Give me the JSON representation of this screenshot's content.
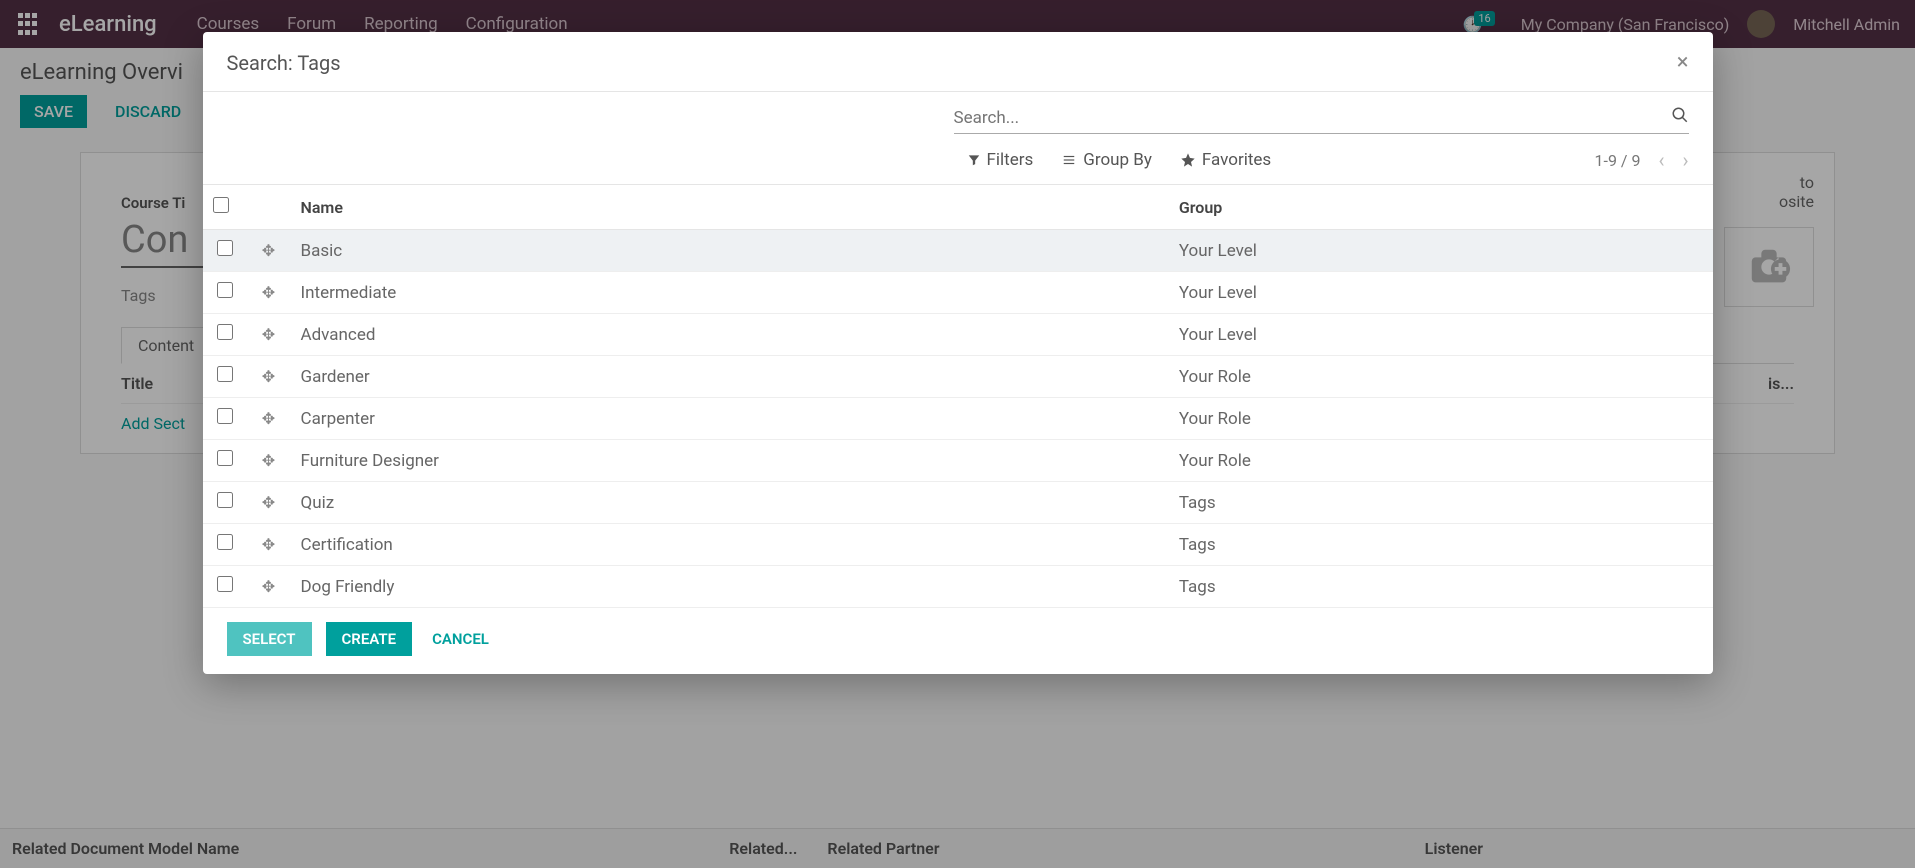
{
  "navbar": {
    "brand": "eLearning",
    "links": [
      "Courses",
      "Forum",
      "Reporting",
      "Configuration"
    ],
    "notif_count": "16",
    "company": "My Company (San Francisco)",
    "user": "Mitchell Admin"
  },
  "page": {
    "breadcrumb": "eLearning Overvi",
    "save": "SAVE",
    "discard": "DISCARD",
    "course_title_label": "Course Ti",
    "course_title_value": "Con",
    "tags_label": "Tags",
    "tabs": [
      "Content"
    ],
    "content_title_header": "Title",
    "add_section": "Add Sect",
    "goto_website_line1": "to",
    "goto_website_line2": "osite",
    "duration_header": "is..."
  },
  "bottom": {
    "c1": "Related Document Model Name",
    "c2": "Related...",
    "c3": "Related Partner",
    "c4": "Listener"
  },
  "modal": {
    "title": "Search: Tags",
    "search_placeholder": "Search...",
    "filters": "Filters",
    "group_by": "Group By",
    "favorites": "Favorites",
    "pager": "1-9 / 9",
    "columns": {
      "name": "Name",
      "group": "Group"
    },
    "rows": [
      {
        "name": "Basic",
        "group": "Your Level"
      },
      {
        "name": "Intermediate",
        "group": "Your Level"
      },
      {
        "name": "Advanced",
        "group": "Your Level"
      },
      {
        "name": "Gardener",
        "group": "Your Role"
      },
      {
        "name": "Carpenter",
        "group": "Your Role"
      },
      {
        "name": "Furniture Designer",
        "group": "Your Role"
      },
      {
        "name": "Quiz",
        "group": "Tags"
      },
      {
        "name": "Certification",
        "group": "Tags"
      },
      {
        "name": "Dog Friendly",
        "group": "Tags"
      }
    ],
    "select": "SELECT",
    "create": "CREATE",
    "cancel": "CANCEL"
  }
}
